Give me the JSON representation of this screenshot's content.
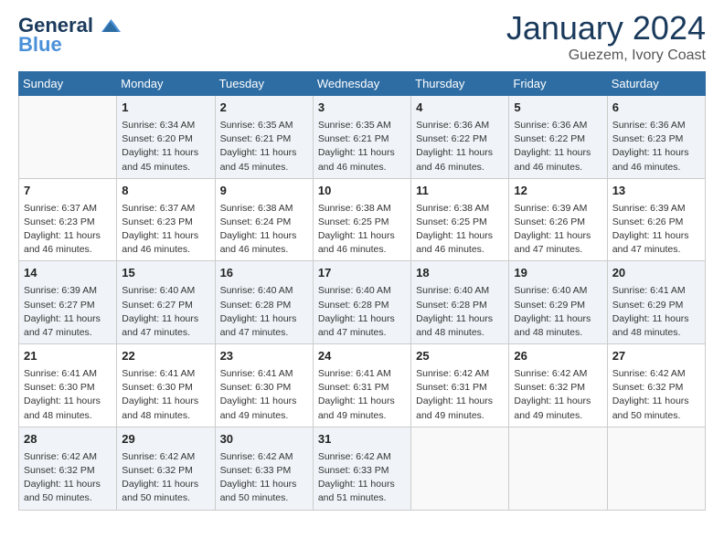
{
  "logo": {
    "line1": "General",
    "line2": "Blue"
  },
  "calendar": {
    "title": "January 2024",
    "subtitle": "Guezem, Ivory Coast"
  },
  "weekdays": [
    "Sunday",
    "Monday",
    "Tuesday",
    "Wednesday",
    "Thursday",
    "Friday",
    "Saturday"
  ],
  "weeks": [
    [
      {
        "day": "",
        "sunrise": "",
        "sunset": "",
        "daylight": ""
      },
      {
        "day": "1",
        "sunrise": "Sunrise: 6:34 AM",
        "sunset": "Sunset: 6:20 PM",
        "daylight": "Daylight: 11 hours and 45 minutes."
      },
      {
        "day": "2",
        "sunrise": "Sunrise: 6:35 AM",
        "sunset": "Sunset: 6:21 PM",
        "daylight": "Daylight: 11 hours and 45 minutes."
      },
      {
        "day": "3",
        "sunrise": "Sunrise: 6:35 AM",
        "sunset": "Sunset: 6:21 PM",
        "daylight": "Daylight: 11 hours and 46 minutes."
      },
      {
        "day": "4",
        "sunrise": "Sunrise: 6:36 AM",
        "sunset": "Sunset: 6:22 PM",
        "daylight": "Daylight: 11 hours and 46 minutes."
      },
      {
        "day": "5",
        "sunrise": "Sunrise: 6:36 AM",
        "sunset": "Sunset: 6:22 PM",
        "daylight": "Daylight: 11 hours and 46 minutes."
      },
      {
        "day": "6",
        "sunrise": "Sunrise: 6:36 AM",
        "sunset": "Sunset: 6:23 PM",
        "daylight": "Daylight: 11 hours and 46 minutes."
      }
    ],
    [
      {
        "day": "7",
        "sunrise": "Sunrise: 6:37 AM",
        "sunset": "Sunset: 6:23 PM",
        "daylight": "Daylight: 11 hours and 46 minutes."
      },
      {
        "day": "8",
        "sunrise": "Sunrise: 6:37 AM",
        "sunset": "Sunset: 6:23 PM",
        "daylight": "Daylight: 11 hours and 46 minutes."
      },
      {
        "day": "9",
        "sunrise": "Sunrise: 6:38 AM",
        "sunset": "Sunset: 6:24 PM",
        "daylight": "Daylight: 11 hours and 46 minutes."
      },
      {
        "day": "10",
        "sunrise": "Sunrise: 6:38 AM",
        "sunset": "Sunset: 6:25 PM",
        "daylight": "Daylight: 11 hours and 46 minutes."
      },
      {
        "day": "11",
        "sunrise": "Sunrise: 6:38 AM",
        "sunset": "Sunset: 6:25 PM",
        "daylight": "Daylight: 11 hours and 46 minutes."
      },
      {
        "day": "12",
        "sunrise": "Sunrise: 6:39 AM",
        "sunset": "Sunset: 6:26 PM",
        "daylight": "Daylight: 11 hours and 47 minutes."
      },
      {
        "day": "13",
        "sunrise": "Sunrise: 6:39 AM",
        "sunset": "Sunset: 6:26 PM",
        "daylight": "Daylight: 11 hours and 47 minutes."
      }
    ],
    [
      {
        "day": "14",
        "sunrise": "Sunrise: 6:39 AM",
        "sunset": "Sunset: 6:27 PM",
        "daylight": "Daylight: 11 hours and 47 minutes."
      },
      {
        "day": "15",
        "sunrise": "Sunrise: 6:40 AM",
        "sunset": "Sunset: 6:27 PM",
        "daylight": "Daylight: 11 hours and 47 minutes."
      },
      {
        "day": "16",
        "sunrise": "Sunrise: 6:40 AM",
        "sunset": "Sunset: 6:28 PM",
        "daylight": "Daylight: 11 hours and 47 minutes."
      },
      {
        "day": "17",
        "sunrise": "Sunrise: 6:40 AM",
        "sunset": "Sunset: 6:28 PM",
        "daylight": "Daylight: 11 hours and 47 minutes."
      },
      {
        "day": "18",
        "sunrise": "Sunrise: 6:40 AM",
        "sunset": "Sunset: 6:28 PM",
        "daylight": "Daylight: 11 hours and 48 minutes."
      },
      {
        "day": "19",
        "sunrise": "Sunrise: 6:40 AM",
        "sunset": "Sunset: 6:29 PM",
        "daylight": "Daylight: 11 hours and 48 minutes."
      },
      {
        "day": "20",
        "sunrise": "Sunrise: 6:41 AM",
        "sunset": "Sunset: 6:29 PM",
        "daylight": "Daylight: 11 hours and 48 minutes."
      }
    ],
    [
      {
        "day": "21",
        "sunrise": "Sunrise: 6:41 AM",
        "sunset": "Sunset: 6:30 PM",
        "daylight": "Daylight: 11 hours and 48 minutes."
      },
      {
        "day": "22",
        "sunrise": "Sunrise: 6:41 AM",
        "sunset": "Sunset: 6:30 PM",
        "daylight": "Daylight: 11 hours and 48 minutes."
      },
      {
        "day": "23",
        "sunrise": "Sunrise: 6:41 AM",
        "sunset": "Sunset: 6:30 PM",
        "daylight": "Daylight: 11 hours and 49 minutes."
      },
      {
        "day": "24",
        "sunrise": "Sunrise: 6:41 AM",
        "sunset": "Sunset: 6:31 PM",
        "daylight": "Daylight: 11 hours and 49 minutes."
      },
      {
        "day": "25",
        "sunrise": "Sunrise: 6:42 AM",
        "sunset": "Sunset: 6:31 PM",
        "daylight": "Daylight: 11 hours and 49 minutes."
      },
      {
        "day": "26",
        "sunrise": "Sunrise: 6:42 AM",
        "sunset": "Sunset: 6:32 PM",
        "daylight": "Daylight: 11 hours and 49 minutes."
      },
      {
        "day": "27",
        "sunrise": "Sunrise: 6:42 AM",
        "sunset": "Sunset: 6:32 PM",
        "daylight": "Daylight: 11 hours and 50 minutes."
      }
    ],
    [
      {
        "day": "28",
        "sunrise": "Sunrise: 6:42 AM",
        "sunset": "Sunset: 6:32 PM",
        "daylight": "Daylight: 11 hours and 50 minutes."
      },
      {
        "day": "29",
        "sunrise": "Sunrise: 6:42 AM",
        "sunset": "Sunset: 6:32 PM",
        "daylight": "Daylight: 11 hours and 50 minutes."
      },
      {
        "day": "30",
        "sunrise": "Sunrise: 6:42 AM",
        "sunset": "Sunset: 6:33 PM",
        "daylight": "Daylight: 11 hours and 50 minutes."
      },
      {
        "day": "31",
        "sunrise": "Sunrise: 6:42 AM",
        "sunset": "Sunset: 6:33 PM",
        "daylight": "Daylight: 11 hours and 51 minutes."
      },
      {
        "day": "",
        "sunrise": "",
        "sunset": "",
        "daylight": ""
      },
      {
        "day": "",
        "sunrise": "",
        "sunset": "",
        "daylight": ""
      },
      {
        "day": "",
        "sunrise": "",
        "sunset": "",
        "daylight": ""
      }
    ]
  ]
}
